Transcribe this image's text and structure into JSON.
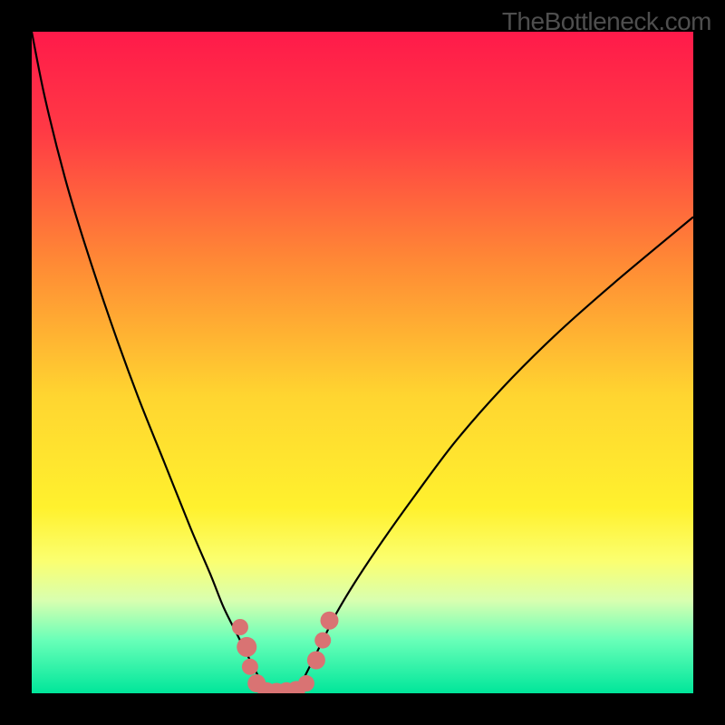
{
  "watermark": "TheBottleneck.com",
  "chart_data": {
    "type": "line",
    "title": "",
    "xlabel": "",
    "ylabel": "",
    "xlim": [
      0,
      100
    ],
    "ylim": [
      0,
      100
    ],
    "background_gradient": {
      "stops": [
        {
          "offset": 0,
          "color": "#ff1a4a"
        },
        {
          "offset": 15,
          "color": "#ff3a45"
        },
        {
          "offset": 35,
          "color": "#ff8a35"
        },
        {
          "offset": 55,
          "color": "#ffd530"
        },
        {
          "offset": 72,
          "color": "#fff12e"
        },
        {
          "offset": 80,
          "color": "#fbff70"
        },
        {
          "offset": 86,
          "color": "#d8ffb0"
        },
        {
          "offset": 92,
          "color": "#68ffb8"
        },
        {
          "offset": 100,
          "color": "#00e69a"
        }
      ]
    },
    "series": [
      {
        "name": "left-curve",
        "x": [
          0,
          2,
          5,
          8,
          12,
          16,
          20,
          24,
          27,
          29,
          31,
          32.5,
          33.5,
          34.5,
          35
        ],
        "y": [
          100,
          90,
          78,
          68,
          56,
          45,
          35,
          25,
          18,
          13,
          9,
          6,
          4,
          2,
          0
        ]
      },
      {
        "name": "right-curve",
        "x": [
          40,
          41,
          42.5,
          44,
          46,
          49,
          53,
          58,
          64,
          71,
          79,
          88,
          100
        ],
        "y": [
          0,
          2,
          5,
          8,
          12,
          17,
          23,
          30,
          38,
          46,
          54,
          62,
          72
        ]
      }
    ],
    "markers": [
      {
        "x": 31.5,
        "y": 10,
        "size": 9
      },
      {
        "x": 32.5,
        "y": 7,
        "size": 11
      },
      {
        "x": 33,
        "y": 4,
        "size": 9
      },
      {
        "x": 34,
        "y": 1.5,
        "size": 10
      },
      {
        "x": 35.5,
        "y": 0.3,
        "size": 10
      },
      {
        "x": 37,
        "y": 0.2,
        "size": 10
      },
      {
        "x": 38.5,
        "y": 0.3,
        "size": 10
      },
      {
        "x": 40,
        "y": 0.5,
        "size": 10
      },
      {
        "x": 41.5,
        "y": 1.5,
        "size": 9
      },
      {
        "x": 43,
        "y": 5,
        "size": 10
      },
      {
        "x": 44,
        "y": 8,
        "size": 9
      },
      {
        "x": 45,
        "y": 11,
        "size": 10
      }
    ],
    "marker_color": "#d97373"
  }
}
